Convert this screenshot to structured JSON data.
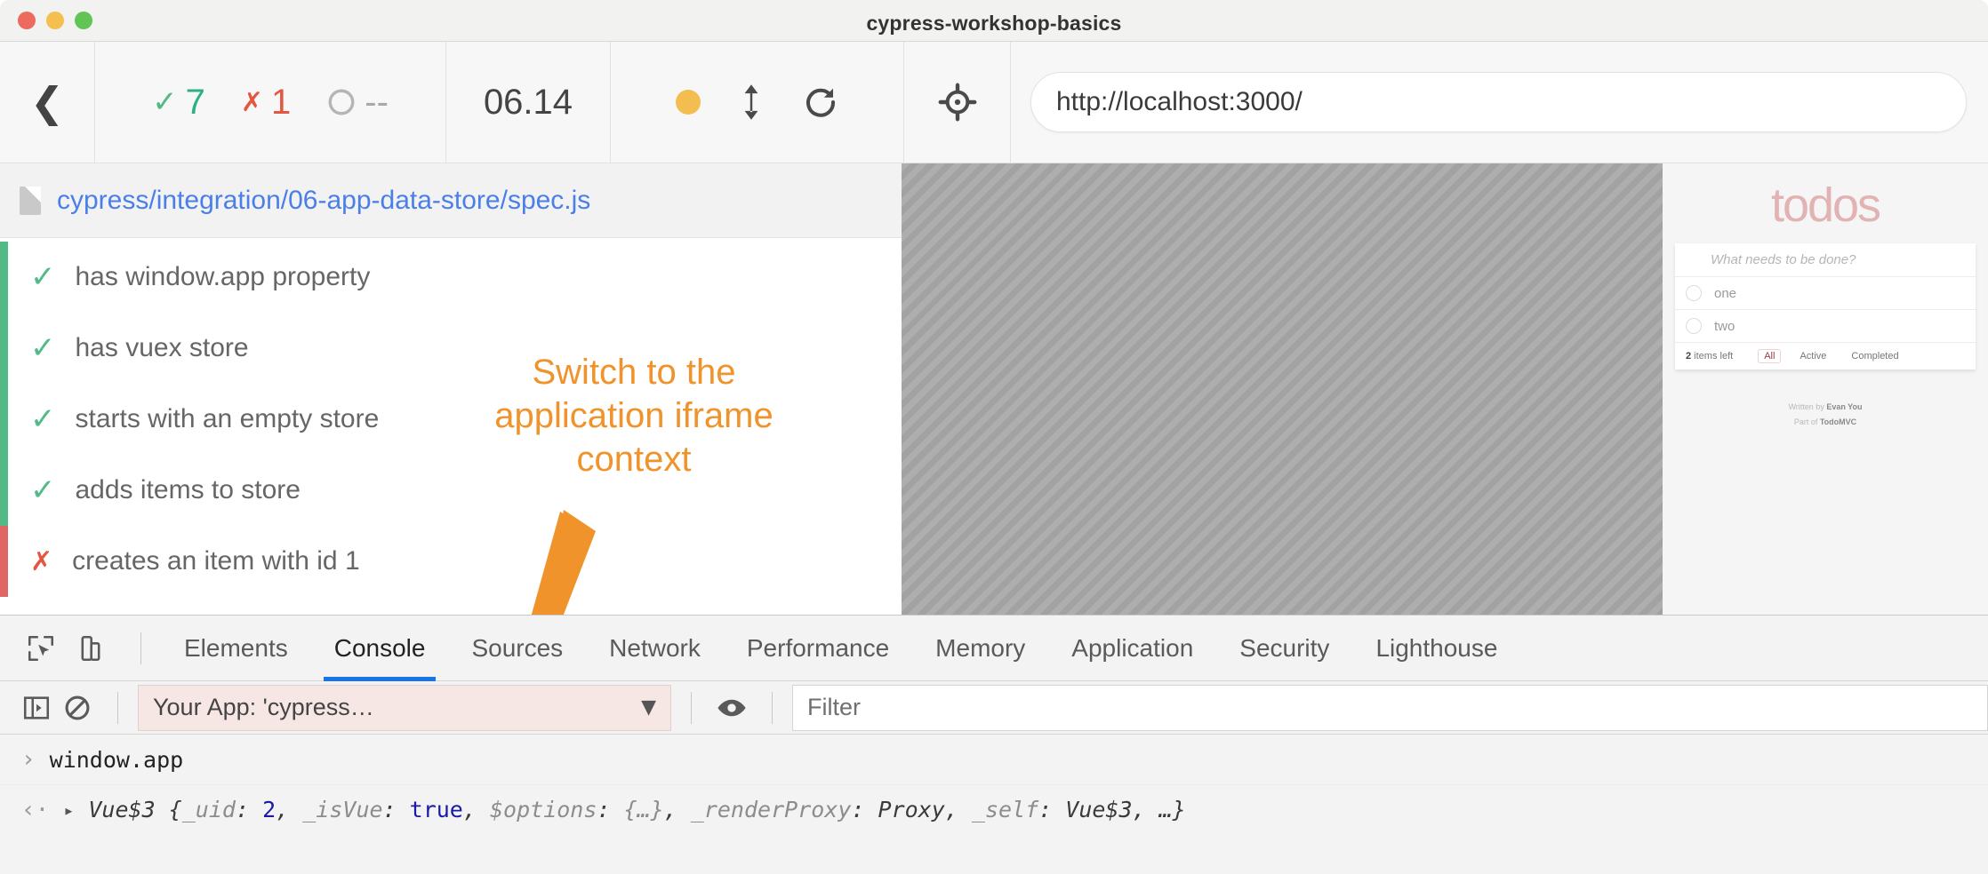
{
  "window": {
    "title": "cypress-workshop-basics"
  },
  "toolbar": {
    "back_icon": "chevron-left-icon",
    "passed_count": "7",
    "failed_count": "1",
    "pending_count": "--",
    "timer": "06.14",
    "viewport_icon": "orange-dot-icon",
    "resize_icon": "vertical-arrows-icon",
    "reload_icon": "reload-icon",
    "selector_icon": "crosshair-target-icon",
    "url": "http://localhost:3000/"
  },
  "reporter": {
    "spec_path": "cypress/integration/06-app-data-store/spec.js",
    "file_icon": "file-icon",
    "tests": [
      {
        "label": "has window.app property",
        "state": "passed"
      },
      {
        "label": "has vuex store",
        "state": "passed"
      },
      {
        "label": "starts with an empty store",
        "state": "passed"
      },
      {
        "label": "adds items to store",
        "state": "passed"
      },
      {
        "label": "creates an item with id 1",
        "state": "failed"
      }
    ],
    "warning_icon": "warning-triangle-icon"
  },
  "annotation": {
    "text": "Switch to the\napplication iframe\ncontext",
    "color": "#f0932b"
  },
  "app_preview": {
    "title": "todos",
    "new_todo_placeholder": "What needs to be done?",
    "items": [
      {
        "label": "one"
      },
      {
        "label": "two"
      }
    ],
    "count_number": "2",
    "count_suffix": " items left",
    "filters": [
      {
        "label": "All",
        "selected": true
      },
      {
        "label": "Active",
        "selected": false
      },
      {
        "label": "Completed",
        "selected": false
      }
    ],
    "credit_written_prefix": "Written by ",
    "credit_written_name": "Evan You",
    "credit_part_prefix": "Part of ",
    "credit_part_name": "TodoMVC"
  },
  "devtools": {
    "inspect_icon": "inspect-element-icon",
    "device_icon": "device-toolbar-icon",
    "tabs": [
      {
        "label": "Elements",
        "active": false
      },
      {
        "label": "Console",
        "active": true
      },
      {
        "label": "Sources",
        "active": false
      },
      {
        "label": "Network",
        "active": false
      },
      {
        "label": "Performance",
        "active": false
      },
      {
        "label": "Memory",
        "active": false
      },
      {
        "label": "Application",
        "active": false
      },
      {
        "label": "Security",
        "active": false
      },
      {
        "label": "Lighthouse",
        "active": false
      }
    ],
    "console_bar": {
      "sidebar_icon": "console-sidebar-icon",
      "clear_icon": "clear-console-icon",
      "context_value": "Your App: 'cypress…",
      "caret_icon": "chevron-down-icon",
      "eye_icon": "live-expression-eye-icon",
      "filter_placeholder": "Filter"
    },
    "console_lines": {
      "input_prompt": "›",
      "input_text": "window.app",
      "output_prompt": "‹·",
      "expand_icon": "▸",
      "out_ctor": "Vue$3",
      "out_open": " {",
      "out_k1": "_uid",
      "out_v1": "2",
      "out_k2": "_isVue",
      "out_v2": "true",
      "out_k3": "$options",
      "out_v3": "{…}",
      "out_k4": "_renderProxy",
      "out_v4": "Proxy",
      "out_k5": "_self",
      "out_v5": "Vue$3",
      "out_tail": ", …}"
    }
  }
}
